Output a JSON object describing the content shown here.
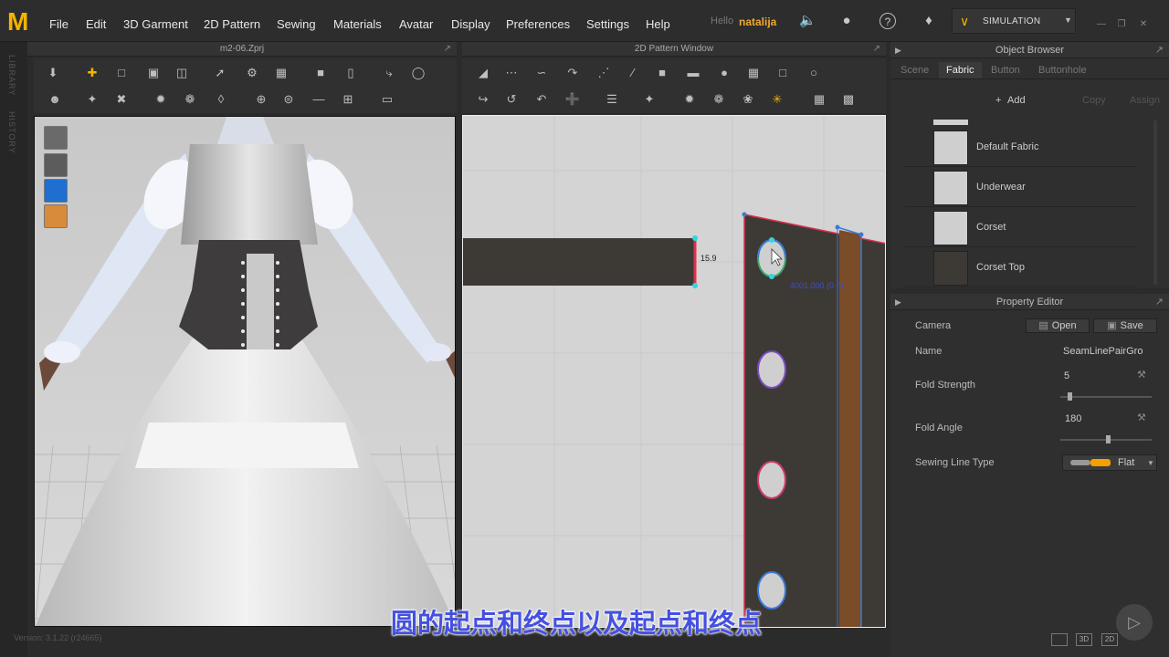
{
  "menubar": {
    "logo": "M",
    "items": [
      "File",
      "Edit",
      "3D Garment",
      "2D Pattern",
      "Sewing",
      "Materials",
      "Avatar",
      "Display",
      "Preferences",
      "Settings",
      "Help"
    ],
    "hello": "Hello",
    "user": "natalija",
    "mode": "SIMULATION",
    "icons": [
      "speaker-icon",
      "user-icon",
      "help-icon",
      "share-icon"
    ]
  },
  "left_strip": {
    "library": "LIBRARY",
    "history": "HISTORY"
  },
  "view3d": {
    "title": "m2-06.Zprj"
  },
  "view2d": {
    "title": "2D Pattern Window",
    "measure": "15.9",
    "selection_label": "4001.000 (0.0)"
  },
  "object_browser": {
    "title": "Object Browser",
    "tabs": [
      "Scene",
      "Fabric",
      "Button",
      "Buttonhole"
    ],
    "active_tab": "Fabric",
    "add": "Add",
    "copy": "Copy",
    "assign": "Assign",
    "fabrics": [
      "Default Fabric",
      "Underwear",
      "Corset",
      "Corset Top"
    ]
  },
  "property_editor": {
    "title": "Property Editor",
    "camera_label": "Camera",
    "open": "Open",
    "save": "Save",
    "name_label": "Name",
    "name_value": "SeamLinePairGro",
    "fold_strength_label": "Fold Strength",
    "fold_strength": "5",
    "fold_angle_label": "Fold Angle",
    "fold_angle": "180",
    "sewing_line_type_label": "Sewing Line Type",
    "sewing_line_type": "Flat"
  },
  "footer": {
    "version": "Version: 3.1.22    (r24665)",
    "view_modes": [
      "3D",
      "2D"
    ]
  },
  "subtitle": "圆的起点和终点以及起点和终点",
  "colors": {
    "accent": "#f5b400",
    "pattern_piece": "#3d3a36",
    "seam_red": "#e0304a",
    "seam_blue": "#3a7ad8",
    "strip_brown": "#7a4c28"
  }
}
